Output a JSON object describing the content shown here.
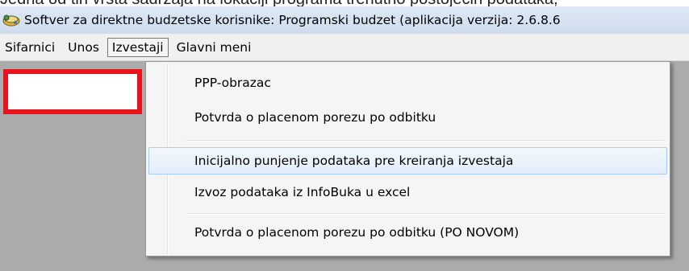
{
  "window": {
    "top_cut_text": "Jedna od tih vrsta sadržaja na lokaciji programa trenutno postojećih podataka,",
    "title": "Softver za direktne budzetske korisnike: Programski budzet (aplikacija verzija: 2.6.8.6"
  },
  "menu": {
    "items": [
      "Sifarnici",
      "Unos",
      "Izvestaji",
      "Glavni meni"
    ],
    "active": "Izvestaji"
  },
  "dropdown": {
    "items": [
      "PPP-obrazac",
      "Potvrda o placenom porezu po odbitku",
      "Inicijalno punjenje podataka pre kreiranja izvestaja",
      "Izvoz podataka iz InfoBuka u excel",
      "Potvrda o placenom porezu po odbitku (PO NOVOM)"
    ],
    "hovered_index": 2
  },
  "colors": {
    "workspace": "#ababab",
    "highlight_box": "#e8141c",
    "title_bar": "#d6e3f2",
    "menu_bar": "#f0f0f0"
  },
  "icons": {
    "app": "app-icon"
  }
}
